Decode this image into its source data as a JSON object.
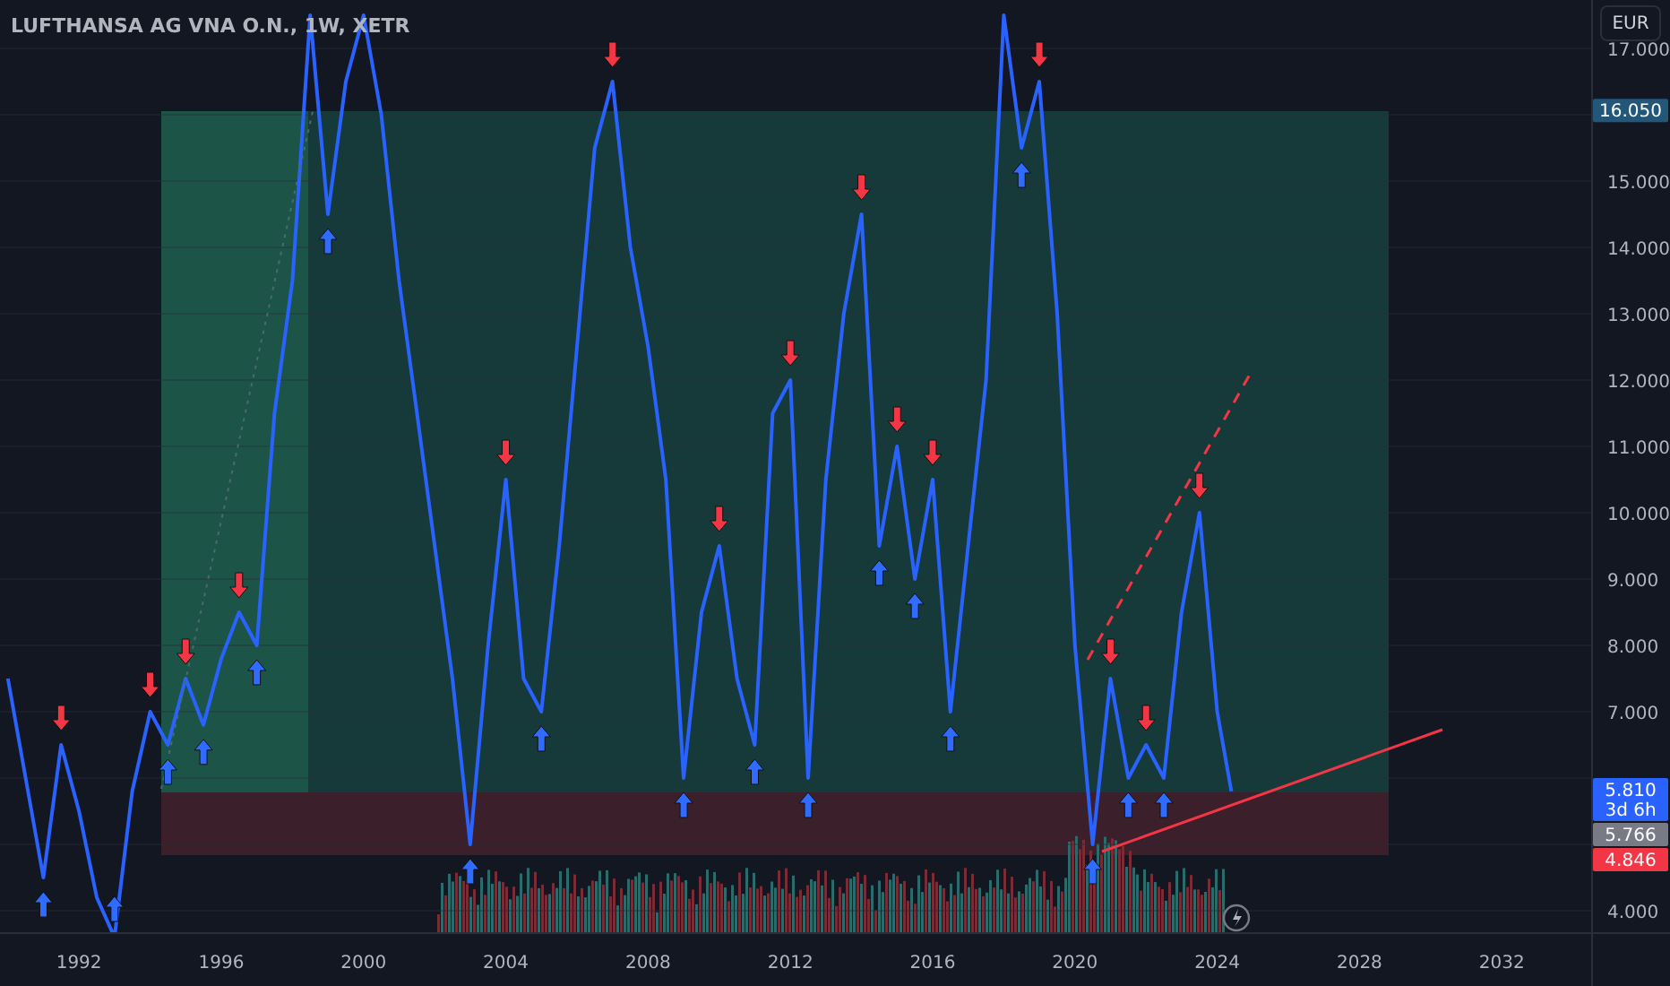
{
  "chart": {
    "chart_data": {
      "type": "line",
      "title": "LUFTHANSA AG VNA O.N., 1W, XETR",
      "x": [
        1990,
        1990.5,
        1991,
        1991.5,
        1992,
        1992.5,
        1993,
        1993.5,
        1994,
        1994.5,
        1995,
        1995.5,
        1996,
        1996.5,
        1997,
        1997.5,
        1998,
        1998.5,
        1999,
        1999.5,
        2000,
        2000.5,
        2001,
        2001.5,
        2002,
        2002.5,
        2003,
        2003.5,
        2004,
        2004.5,
        2005,
        2005.5,
        2006,
        2006.5,
        2007,
        2007.5,
        2008,
        2008.5,
        2009,
        2009.5,
        2010,
        2010.5,
        2011,
        2011.5,
        2012,
        2012.5,
        2013,
        2013.5,
        2014,
        2014.5,
        2015,
        2015.5,
        2016,
        2016.5,
        2017,
        2017.5,
        2018,
        2018.5,
        2019,
        2019.5,
        2020,
        2020.5,
        2021,
        2021.5,
        2022,
        2022.5,
        2023,
        2023.5,
        2024,
        2024.4
      ],
      "series": [
        {
          "color": "#2962ff",
          "values": [
            7.5,
            6.0,
            4.5,
            6.5,
            5.5,
            4.2,
            3.6,
            5.8,
            7.0,
            6.5,
            7.5,
            6.8,
            7.8,
            8.5,
            8.0,
            11.5,
            13.5,
            17.5,
            14.5,
            16.5,
            17.5,
            16.0,
            13.5,
            11.5,
            9.5,
            7.5,
            5.0,
            8.0,
            10.5,
            7.5,
            7.0,
            9.5,
            12.5,
            15.5,
            16.5,
            14.0,
            12.5,
            10.5,
            6.0,
            8.5,
            9.5,
            7.5,
            6.5,
            11.5,
            12.0,
            6.0,
            10.5,
            13.0,
            14.5,
            9.5,
            11.0,
            9.0,
            10.5,
            7.0,
            9.5,
            12.0,
            17.5,
            15.5,
            16.5,
            13.0,
            8.0,
            5.0,
            7.5,
            6.0,
            6.5,
            6.0,
            8.5,
            10.0,
            7.0,
            5.8
          ]
        }
      ],
      "xlim": [
        1989.78,
        2036.73
      ],
      "ylim": [
        2.865,
        17.73
      ],
      "grid": true,
      "xticks": [
        1992,
        1996,
        2000,
        2004,
        2008,
        2012,
        2016,
        2020,
        2024,
        2028,
        2032
      ],
      "yticks": [
        {
          "value": 4,
          "label": "4.000"
        },
        {
          "value": 7,
          "label": "7.000"
        },
        {
          "value": 8,
          "label": "8.000"
        },
        {
          "value": 9,
          "label": "9.000"
        },
        {
          "value": 10,
          "label": "10.000"
        },
        {
          "value": 11,
          "label": "11.000"
        },
        {
          "value": 12,
          "label": "12.000"
        },
        {
          "value": 13,
          "label": "13.000"
        },
        {
          "value": 14,
          "label": "14.000"
        },
        {
          "value": 15,
          "label": "15.000"
        },
        {
          "value": 17,
          "label": "17.000"
        }
      ]
    }
  },
  "currency_button": "EUR",
  "price_tags": [
    {
      "label": "16.050",
      "color": "#22577a"
    },
    {
      "label": "5.810",
      "sub": "3d 6h",
      "color": "#2962ff"
    },
    {
      "label": "5.766",
      "color": "#787b86"
    },
    {
      "label": "4.846",
      "color": "#f23645"
    }
  ]
}
